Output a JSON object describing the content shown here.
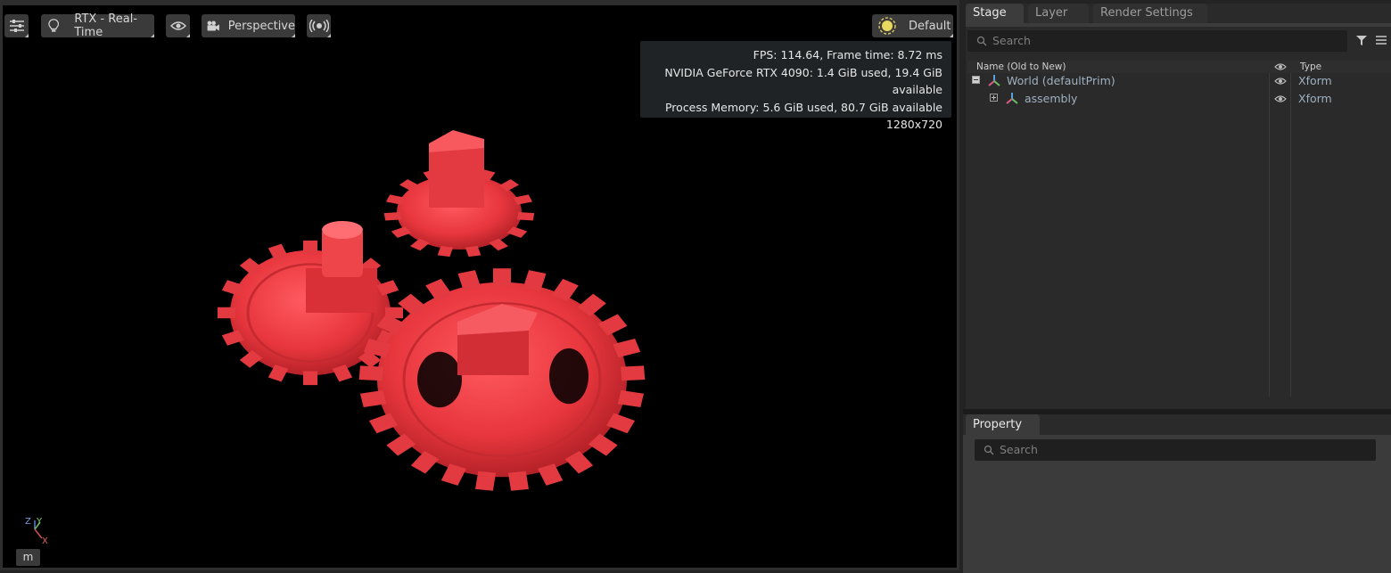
{
  "viewport": {
    "toolbar": {
      "renderer_label": "RTX - Real-Time",
      "camera_label": "Perspective",
      "lighting_label": "Default"
    },
    "stats": {
      "fps_line": "FPS: 114.64, Frame time: 8.72 ms",
      "gpu_line": "NVIDIA GeForce RTX 4090: 1.4 GiB used, 19.4 GiB available",
      "memory_line": "Process Memory: 5.6 GiB used, 80.7 GiB available",
      "resolution_line": "1280x720"
    },
    "axes": {
      "z": "Z",
      "y": "Y",
      "x": "X"
    },
    "units_button": "m",
    "model_color": "#e8363d"
  },
  "stage_panel": {
    "tabs": [
      "Stage",
      "Layer",
      "Render Settings"
    ],
    "search_placeholder": "Search",
    "columns": {
      "name": "Name (Old to New)",
      "type": "Type"
    },
    "rows": [
      {
        "name": "World (defaultPrim)",
        "type": "Xform",
        "expander": "−"
      },
      {
        "name": "assembly",
        "type": "Xform",
        "expander": "+"
      }
    ]
  },
  "property_panel": {
    "tab": "Property",
    "search_placeholder": "Search"
  }
}
